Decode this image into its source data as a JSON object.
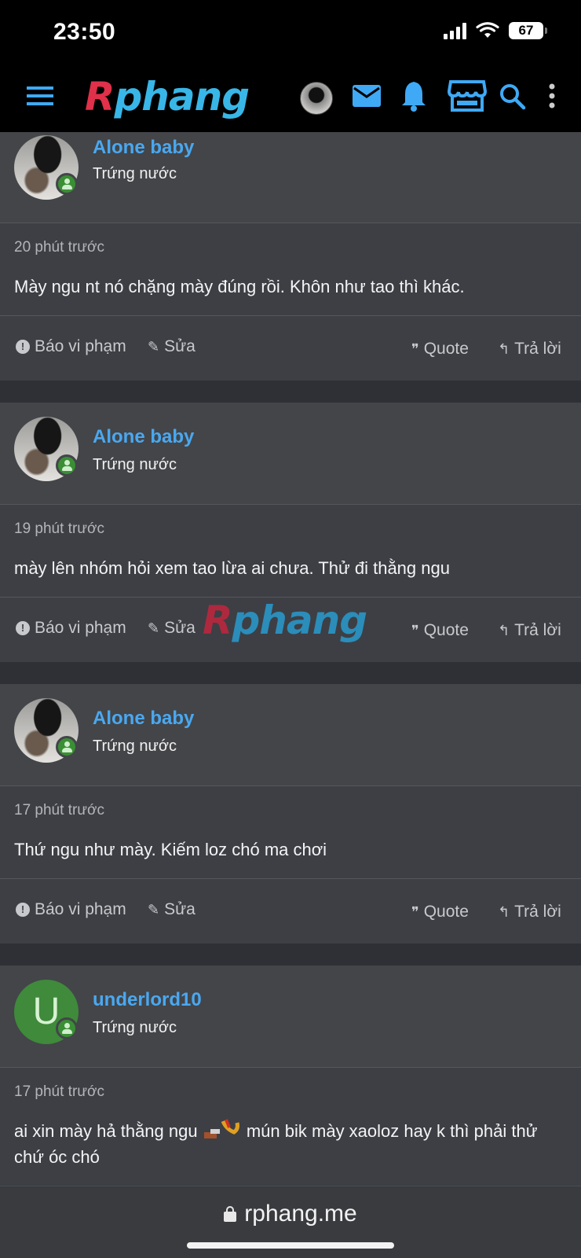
{
  "status_bar": {
    "time": "23:50",
    "battery": "67"
  },
  "header": {
    "logo_first": "R",
    "logo_rest": "phang"
  },
  "watermark": {
    "first": "R",
    "rest": "phang"
  },
  "posts": [
    {
      "username": "Alone baby",
      "rank": "Trứng nước",
      "time": "20 phút trước",
      "content": "Mày ngu nt nó chặng mày đúng rồi. Khôn như tao thì khác."
    },
    {
      "username": "Alone baby",
      "rank": "Trứng nước",
      "time": "19 phút trước",
      "content": "mày lên nhóm hỏi xem tao lừa ai chưa. Thử đi thằng ngu"
    },
    {
      "username": "Alone baby",
      "rank": "Trứng nước",
      "time": "17 phút trước",
      "content": "Thứ ngu như mày. Kiếm loz chó ma chơi"
    },
    {
      "username": "underlord10",
      "avatar_letter": "U",
      "rank": "Trứng nước",
      "time": "17 phút trước",
      "content_before": "ai xin mày hả thằng ngu",
      "content_after": "mún bik mày xaoloz hay k thì phải thử chứ óc chó"
    }
  ],
  "actions": {
    "report": "Báo vi phạm",
    "edit": "Sửa",
    "quote": "Quote",
    "reply": "Trả lời"
  },
  "browser": {
    "url": "rphang.me"
  },
  "colors": {
    "accent": "#4aa8f0",
    "online": "#3a8f35",
    "logo_red": "#e0304a",
    "logo_blue": "#38b6e8"
  }
}
